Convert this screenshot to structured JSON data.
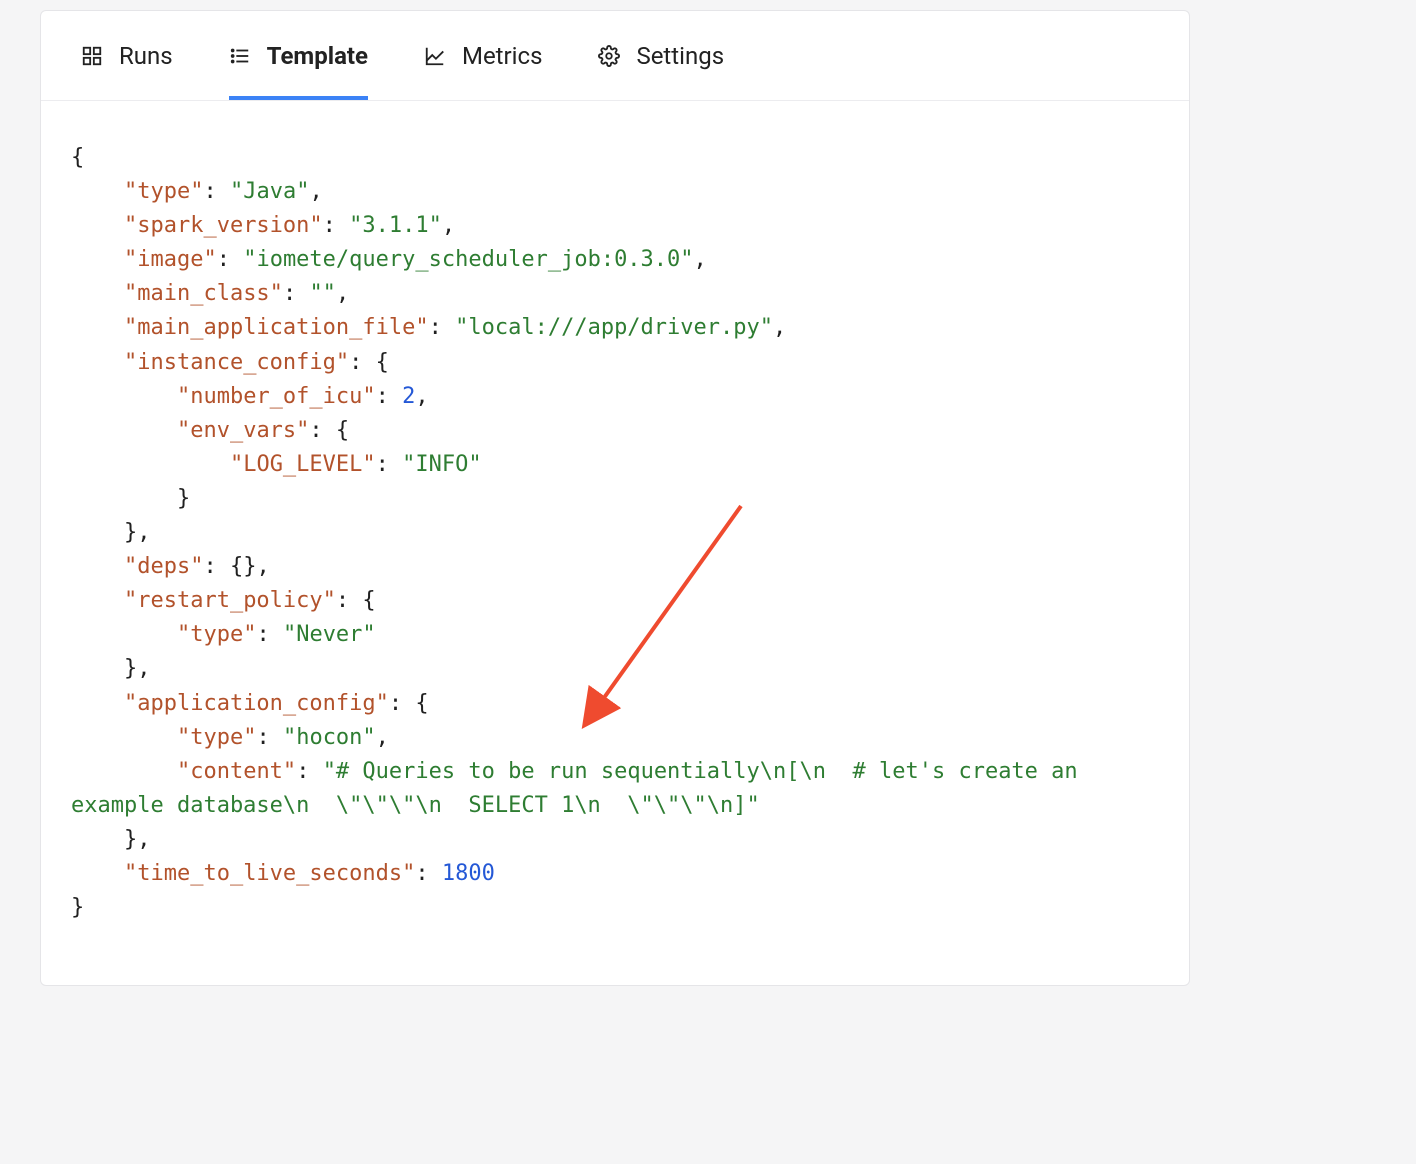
{
  "tabs": {
    "runs": {
      "label": "Runs"
    },
    "template": {
      "label": "Template"
    },
    "metrics": {
      "label": "Metrics"
    },
    "settings": {
      "label": "Settings"
    }
  },
  "code": {
    "l1": "{",
    "k_type": "\"type\"",
    "v_type": "\"Java\"",
    "k_sparkv": "\"spark_version\"",
    "v_sparkv": "\"3.1.1\"",
    "k_image": "\"image\"",
    "v_image": "\"iomete/query_scheduler_job:0.3.0\"",
    "k_main_class": "\"main_class\"",
    "v_main_class": "\"\"",
    "k_main_app": "\"main_application_file\"",
    "v_main_app": "\"local:///app/driver.py\"",
    "k_inst": "\"instance_config\"",
    "k_icu": "\"number_of_icu\"",
    "v_icu": "2",
    "k_env": "\"env_vars\"",
    "k_log": "\"LOG_LEVEL\"",
    "v_log": "\"INFO\"",
    "k_deps": "\"deps\"",
    "k_restart": "\"restart_policy\"",
    "k_rtype": "\"type\"",
    "v_rtype": "\"Never\"",
    "k_appcfg": "\"application_config\"",
    "k_atype": "\"type\"",
    "v_atype": "\"hocon\"",
    "k_content": "\"content\"",
    "v_content": "\"# Queries to be run sequentially\\n[\\n  # let's create an example database\\n  \\\"\\\"\\\"\\n  SELECT 1\\n  \\\"\\\"\\\"\\n]\"",
    "k_ttl": "\"time_to_live_seconds\"",
    "v_ttl": "1800"
  },
  "colors": {
    "accent": "#3b82f6",
    "arrow": "#ef4b2f"
  }
}
